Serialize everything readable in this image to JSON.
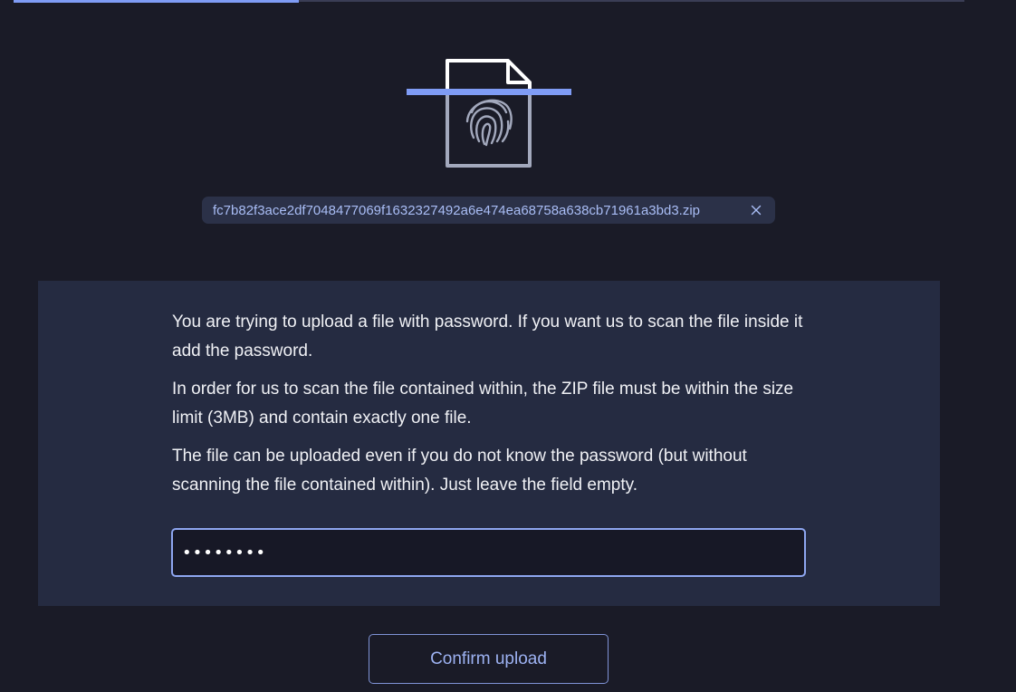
{
  "upload": {
    "progress": 0.3,
    "file_icon": "fingerprint-document-icon",
    "file_name": "fc7b82f3ace2df7048477069f1632327492a6e474ea68758a638cb71961a3bd3.zip",
    "remove_icon": "close-icon",
    "remove_glyph": "×"
  },
  "password_panel": {
    "paragraph_1": "You are trying to upload a file with password. If you want us to scan the file inside it add the password.",
    "paragraph_2": "In order for us to scan the file contained within, the ZIP file must be within the size limit (3MB) and contain exactly one file.",
    "paragraph_3": "The file can be uploaded even if you do not know the password (but without scanning the file contained within). Just leave the field empty.",
    "password_value": "••••••••"
  },
  "actions": {
    "confirm_label": "Confirm upload"
  },
  "colors": {
    "background": "#1a1b27",
    "panel": "#252b41",
    "accent": "#7f9cf5",
    "chip": "#2b3148"
  }
}
